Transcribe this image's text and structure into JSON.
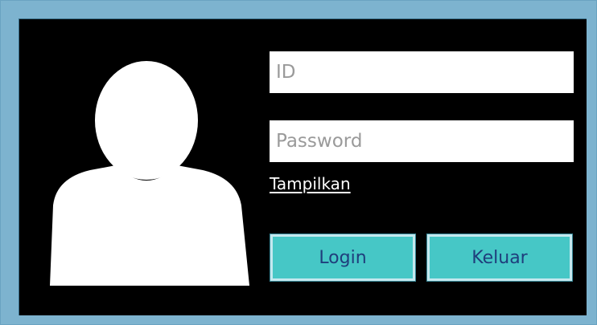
{
  "login_form": {
    "id_placeholder": "ID",
    "id_value": "",
    "password_placeholder": "Password",
    "password_value": "",
    "show_password_label": "Tampilkan",
    "login_label": "Login",
    "exit_label": "Keluar"
  },
  "icons": {
    "avatar": "user-silhouette-icon"
  },
  "colors": {
    "frame": "#7db3cf",
    "panel": "#000000",
    "button_fill": "#46c7c6",
    "button_text": "#1f3e7c",
    "field_bg": "#ffffff",
    "placeholder": "#9a9a9a"
  }
}
